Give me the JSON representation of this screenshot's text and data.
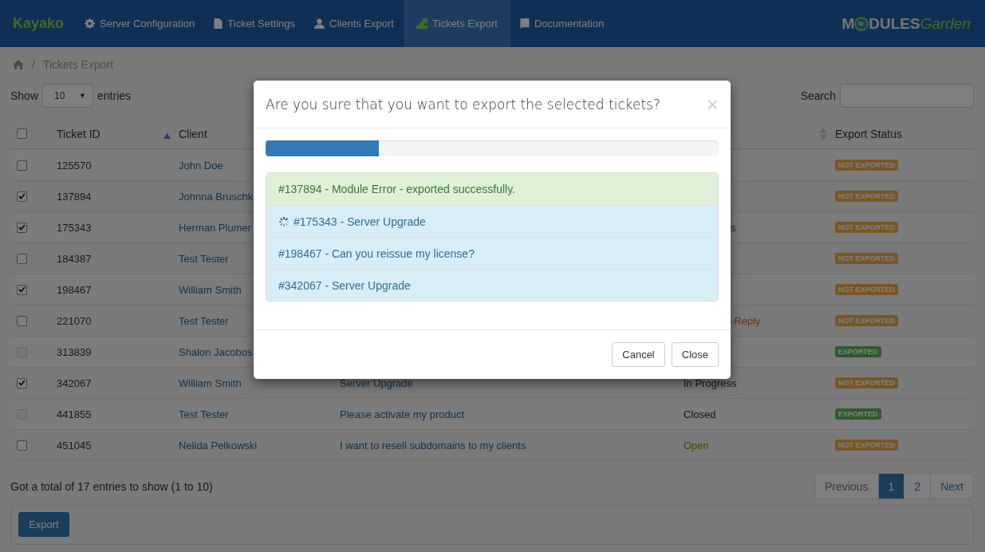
{
  "navbar": {
    "brand": "Kayako",
    "items": [
      {
        "label": "Server Configuration",
        "selected": false
      },
      {
        "label": "Ticket Settings",
        "selected": false
      },
      {
        "label": "Clients Export",
        "selected": false
      },
      {
        "label": "Tickets Export",
        "selected": true
      },
      {
        "label": "Documentation",
        "selected": false
      }
    ],
    "logo": {
      "before": "M",
      "after": "DULES",
      "script": "Garden"
    }
  },
  "breadcrumb": {
    "separator": "/",
    "current": "Tickets Export"
  },
  "length_menu": {
    "before": "Show",
    "value": "10",
    "caret": "▼",
    "after": "entries"
  },
  "search": {
    "label": "Search"
  },
  "table": {
    "columns": [
      {
        "label": "Ticket ID"
      },
      {
        "label": "Client"
      },
      {
        "label": "Export Status"
      }
    ],
    "header_checked": false,
    "rows": [
      {
        "id": "125570",
        "client": "John Doe",
        "checked": false,
        "disabled": false,
        "export": {
          "kind": "not",
          "label": "NOT EXPORTED"
        }
      },
      {
        "id": "137894",
        "client": "Johnna Bruschk",
        "checked": true,
        "disabled": false,
        "export": {
          "kind": "not",
          "label": "NOT EXPORTED"
        }
      },
      {
        "id": "175343",
        "client": "Herman Plumer",
        "checked": true,
        "disabled": false,
        "status": {
          "text": "s",
          "kind": "plain"
        },
        "export": {
          "kind": "not",
          "label": "NOT EXPORTED"
        }
      },
      {
        "id": "184387",
        "client": "Test Tester",
        "checked": false,
        "disabled": false,
        "export": {
          "kind": "not",
          "label": "NOT EXPORTED"
        }
      },
      {
        "id": "198467",
        "client": "William Smith",
        "checked": true,
        "disabled": false,
        "export": {
          "kind": "not",
          "label": "NOT EXPORTED"
        }
      },
      {
        "id": "221070",
        "client": "Test Tester",
        "checked": false,
        "disabled": false,
        "status": {
          "text": "-Reply",
          "kind": "reply"
        },
        "export": {
          "kind": "not",
          "label": "NOT EXPORTED"
        }
      },
      {
        "id": "313839",
        "client": "Shalon Jacobos",
        "checked": false,
        "disabled": true,
        "export": {
          "kind": "done",
          "label": "EXPORTED"
        }
      },
      {
        "id": "342067",
        "client": "William Smith",
        "checked": true,
        "disabled": false,
        "subject": "Server Upgrade",
        "status": {
          "text": "In Progress",
          "kind": "plain"
        },
        "export": {
          "kind": "not",
          "label": "NOT EXPORTED"
        }
      },
      {
        "id": "441855",
        "client": "Test Tester",
        "checked": false,
        "disabled": true,
        "subject": "Please activate my product",
        "status": {
          "text": "Closed",
          "kind": "plain"
        },
        "export": {
          "kind": "done",
          "label": "EXPORTED"
        }
      },
      {
        "id": "451045",
        "client": "Nelida Pelkowski",
        "checked": false,
        "disabled": false,
        "subject": "I want to resell subdomains to my clients",
        "status": {
          "text": "Open",
          "kind": "open"
        },
        "export": {
          "kind": "not",
          "label": "NOT EXPORTED"
        }
      }
    ]
  },
  "info": "Got a total of 17 entries to show (1 to 10)",
  "pagination": [
    {
      "label": "Previous",
      "selected": false
    },
    {
      "label": "1",
      "selected": true
    },
    {
      "label": "2",
      "selected": false
    },
    {
      "label": "Next",
      "selected": false
    }
  ],
  "export_button": "Export",
  "modal": {
    "title": "Are you sure that you want to export the selected tickets?",
    "close": "×",
    "progress": {
      "level": 0.25
    },
    "items": [
      {
        "text": "#137894 - Module Error - exported successfully.",
        "kind": "success",
        "loading": false
      },
      {
        "text": "#175343 - Server Upgrade",
        "kind": "info",
        "loading": true
      },
      {
        "text": "#198467 - Can you reissue my license?",
        "kind": "info",
        "loading": false
      },
      {
        "text": "#342067 - Server Upgrade",
        "kind": "info",
        "loading": false
      }
    ],
    "buttons": [
      "Cancel",
      "Close"
    ]
  }
}
